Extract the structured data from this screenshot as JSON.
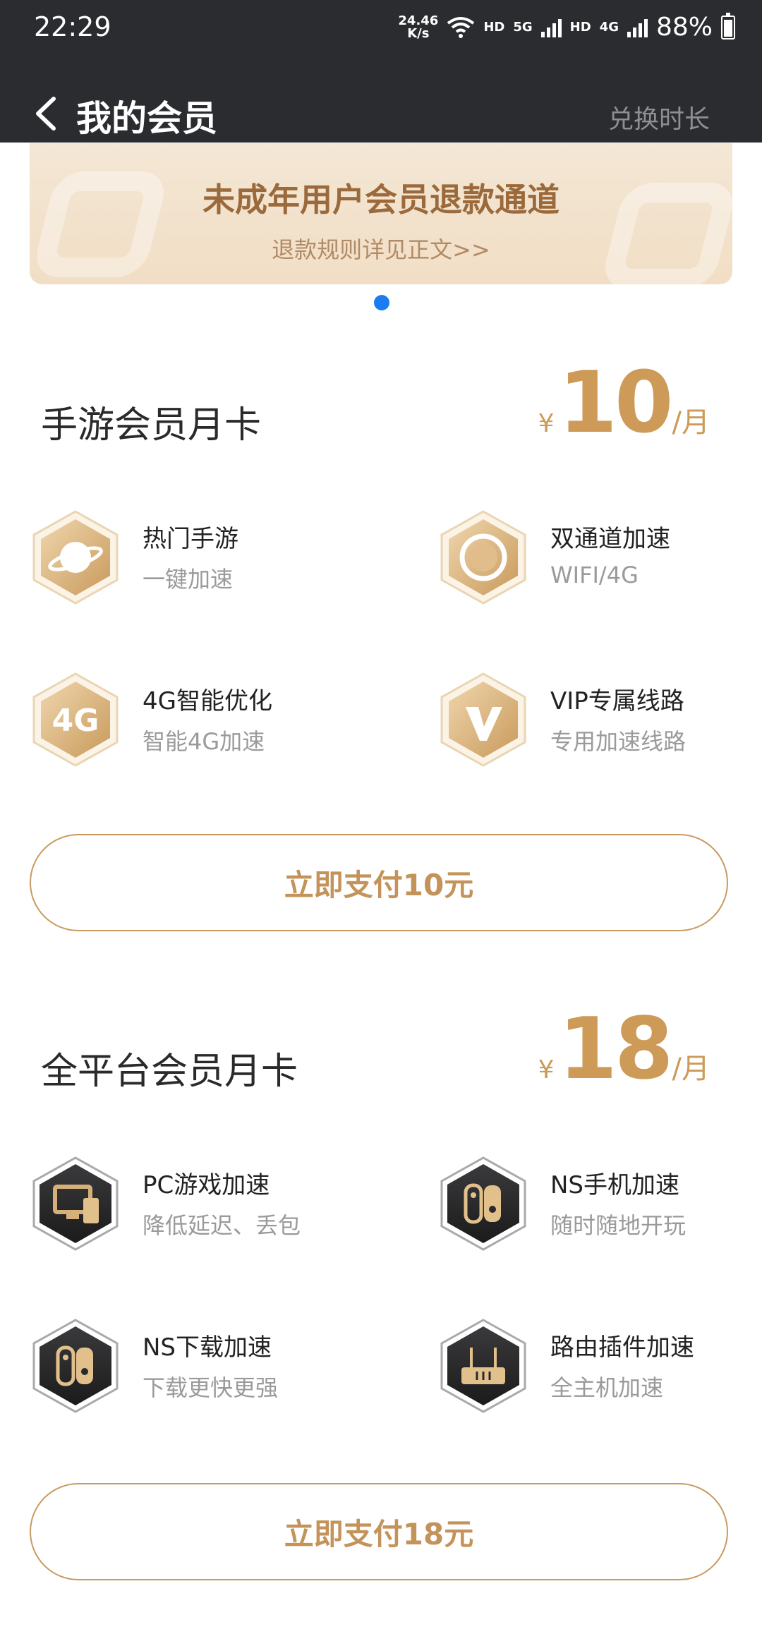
{
  "status_bar": {
    "time": "22:29",
    "net_speed_value": "24.46",
    "net_speed_unit": "K/s",
    "hd1": "HD",
    "net1": "5G",
    "hd2": "HD",
    "net2": "4G",
    "battery": "88%"
  },
  "header": {
    "title": "我的会员",
    "action": "兑换时长"
  },
  "banner": {
    "title": "未成年用户会员退款通道",
    "subtitle": "退款规则详见正文>>"
  },
  "plans": [
    {
      "name": "手游会员月卡",
      "currency": "¥",
      "price": "10",
      "unit": "/月",
      "features": [
        {
          "title": "热门手游",
          "subtitle": "一键加速",
          "icon": "planet-icon"
        },
        {
          "title": "双通道加速",
          "subtitle": "WIFI/4G",
          "icon": "dual-channel-icon"
        },
        {
          "title": "4G智能优化",
          "subtitle": "智能4G加速",
          "icon": "4g-icon",
          "icon_text": "4G"
        },
        {
          "title": "VIP专属线路",
          "subtitle": "专用加速线路",
          "icon": "vip-icon"
        }
      ],
      "pay_label": "立即支付10元"
    },
    {
      "name": "全平台会员月卡",
      "currency": "¥",
      "price": "18",
      "unit": "/月",
      "features": [
        {
          "title": "PC游戏加速",
          "subtitle": "降低延迟、丢包",
          "icon": "pc-icon"
        },
        {
          "title": "NS手机加速",
          "subtitle": "随时随地开玩",
          "icon": "switch-icon"
        },
        {
          "title": "NS下载加速",
          "subtitle": "下载更快更强",
          "icon": "switch-download-icon"
        },
        {
          "title": "路由插件加速",
          "subtitle": "全主机加速",
          "icon": "router-icon"
        }
      ],
      "pay_label": "立即支付18元"
    }
  ],
  "colors": {
    "topbar": "#2b2c30",
    "gold": "#cd9a58",
    "indicator": "#1a7cf0"
  }
}
